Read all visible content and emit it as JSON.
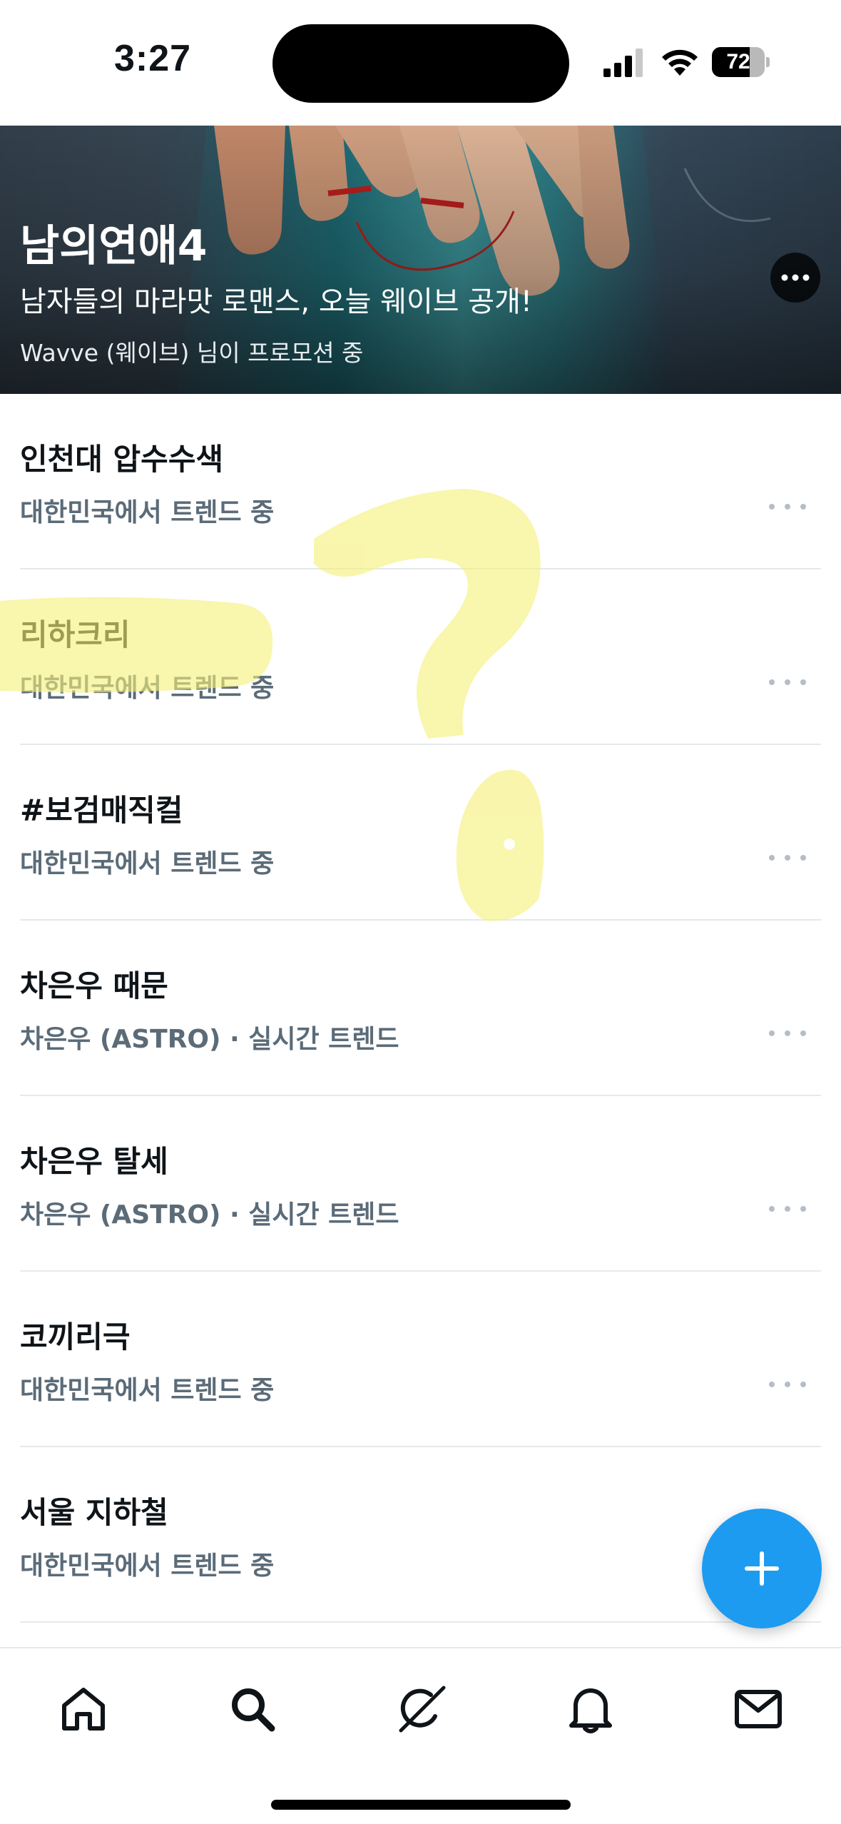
{
  "status_bar": {
    "time": "3:27",
    "battery_level": 72,
    "battery_label": "72"
  },
  "promo": {
    "title": "남의연애4",
    "subtitle": "남자들의 마라맛 로맨스, 오늘 웨이브 공개!",
    "promoted_by": "Wavve (웨이브) 님이 프로모션 중",
    "more_icon": "more-horizontal-icon"
  },
  "trends": [
    {
      "title": "인천대 압수수색",
      "meta": "대한민국에서 트렌드 중"
    },
    {
      "title": "리하크리",
      "meta": "대한민국에서 트렌드 중"
    },
    {
      "title": "#보검매직컬",
      "meta": "대한민국에서 트렌드 중"
    },
    {
      "title": "차은우 때문",
      "meta": "차은우 (ASTRO) · 실시간 트렌드"
    },
    {
      "title": "차은우 탈세",
      "meta": "차은우 (ASTRO) · 실시간 트렌드"
    },
    {
      "title": "코끼리극",
      "meta": "대한민국에서 트렌드 중"
    },
    {
      "title": "서울 지하철",
      "meta": "대한민국에서 트렌드 중"
    }
  ],
  "fab": {
    "icon": "plus-icon"
  },
  "bottom_nav": {
    "items": [
      {
        "icon": "home-icon"
      },
      {
        "icon": "search-icon"
      },
      {
        "icon": "grok-icon"
      },
      {
        "icon": "bell-icon"
      },
      {
        "icon": "mail-icon"
      }
    ]
  },
  "colors": {
    "accent": "#1d9bf0",
    "highlighter": "#f6f07a",
    "secondary_text": "#5b6b78"
  }
}
